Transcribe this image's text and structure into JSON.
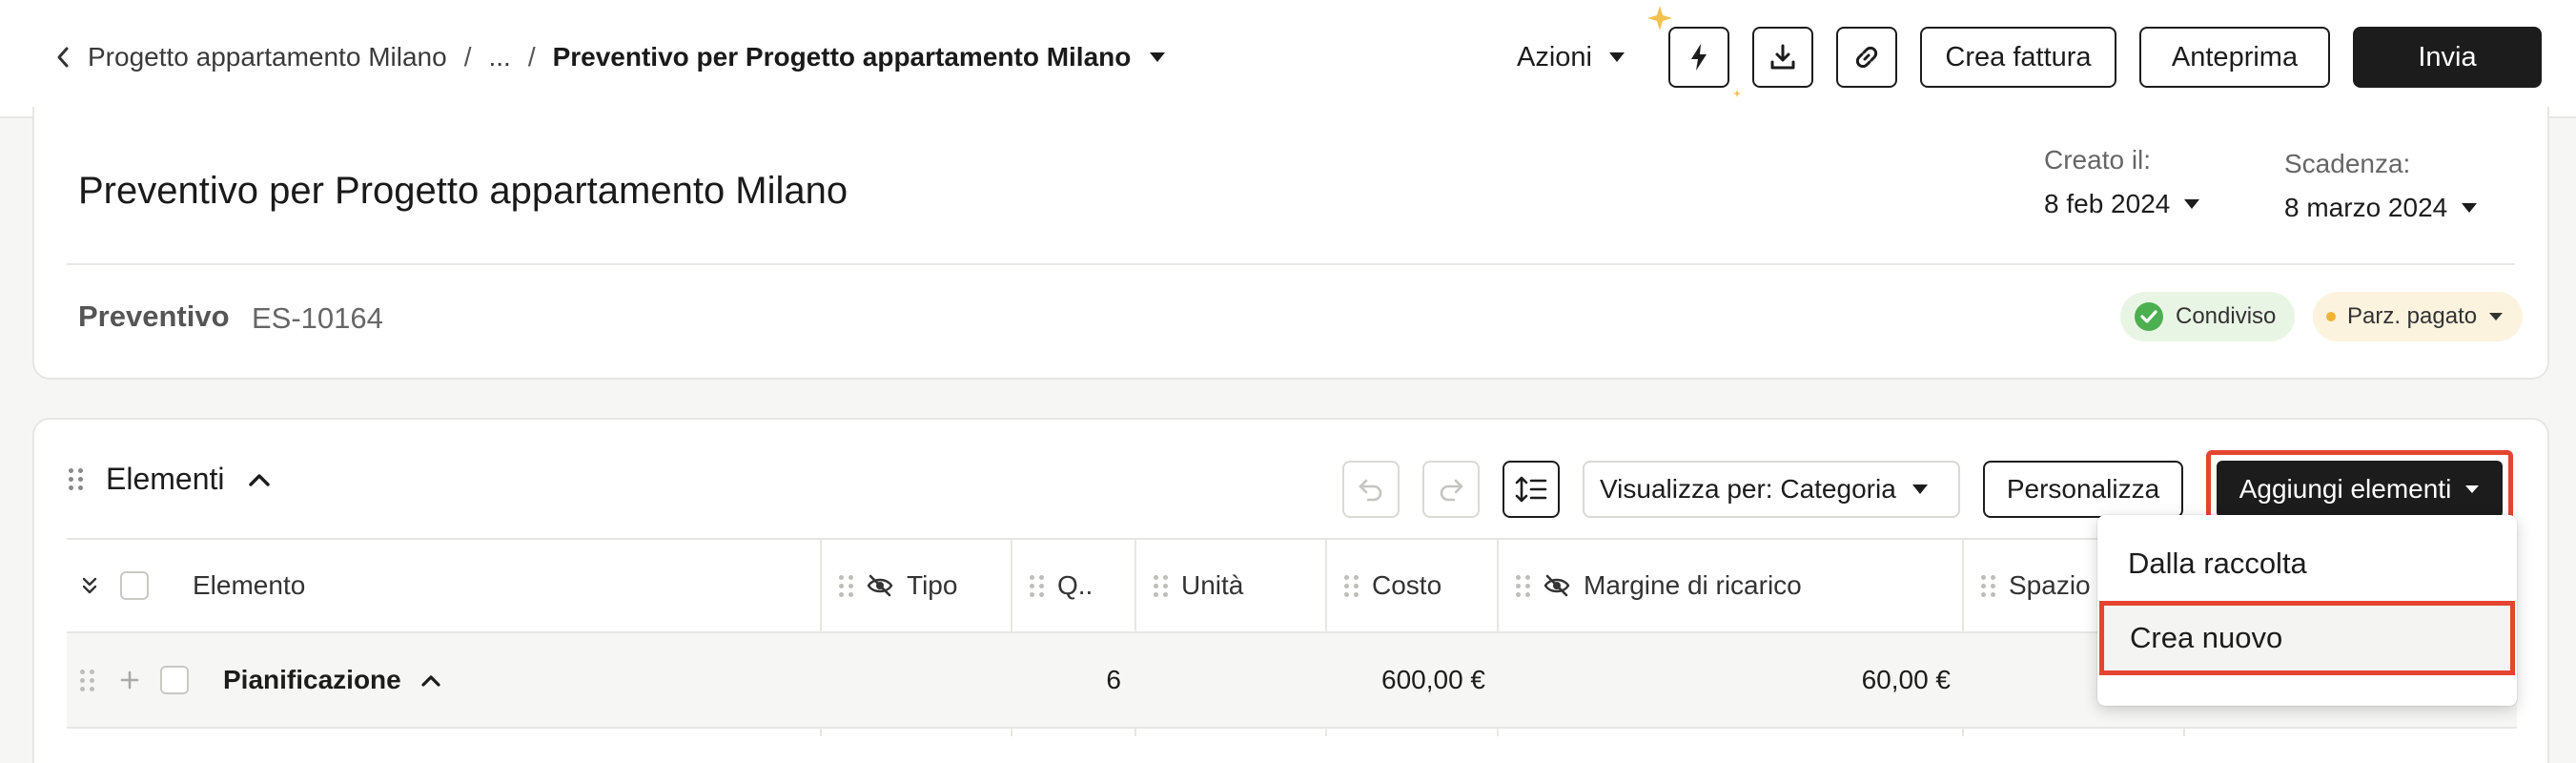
{
  "header": {
    "breadcrumb": {
      "parent": "Progetto appartamento Milano",
      "sep1": "/",
      "ellipsis": "...",
      "sep2": "/",
      "current": "Preventivo per Progetto appartamento Milano"
    },
    "actions_label": "Azioni",
    "buttons": {
      "create_invoice": "Crea fattura",
      "preview": "Anteprima",
      "send": "Invia"
    },
    "icons": [
      "lightning-icon",
      "download-icon",
      "link-icon"
    ]
  },
  "document": {
    "title": "Preventivo per Progetto appartamento Milano",
    "created_label": "Creato il:",
    "created_value": "8 feb 2024",
    "due_label": "Scadenza:",
    "due_value": "8 marzo 2024",
    "type": "Preventivo",
    "number": "ES-10164",
    "status_shared": "Condiviso",
    "status_payment": "Parz. pagato",
    "colors": {
      "shared_bg": "#e9f5e4",
      "shared_check": "#4caf50",
      "payment_bg": "#fcf3df",
      "payment_dot": "#f2b233"
    }
  },
  "items": {
    "title": "Elementi",
    "view_by": "Visualizza per: Categoria",
    "customize": "Personalizza",
    "add_items": "Aggiungi elementi",
    "columns": {
      "element": "Elemento",
      "type": "Tipo",
      "qty": "Q..",
      "unit": "Unità",
      "cost": "Costo",
      "markup": "Margine di ricarico",
      "space": "Spazio"
    },
    "rows": [
      {
        "name": "Pianificazione",
        "qty": "6",
        "cost": "600,00 €",
        "markup": "60,00 €"
      }
    ],
    "menu": {
      "from_collection": "Dalla raccolta",
      "create_new": "Crea nuovo"
    },
    "highlight_color": "#e44530"
  }
}
